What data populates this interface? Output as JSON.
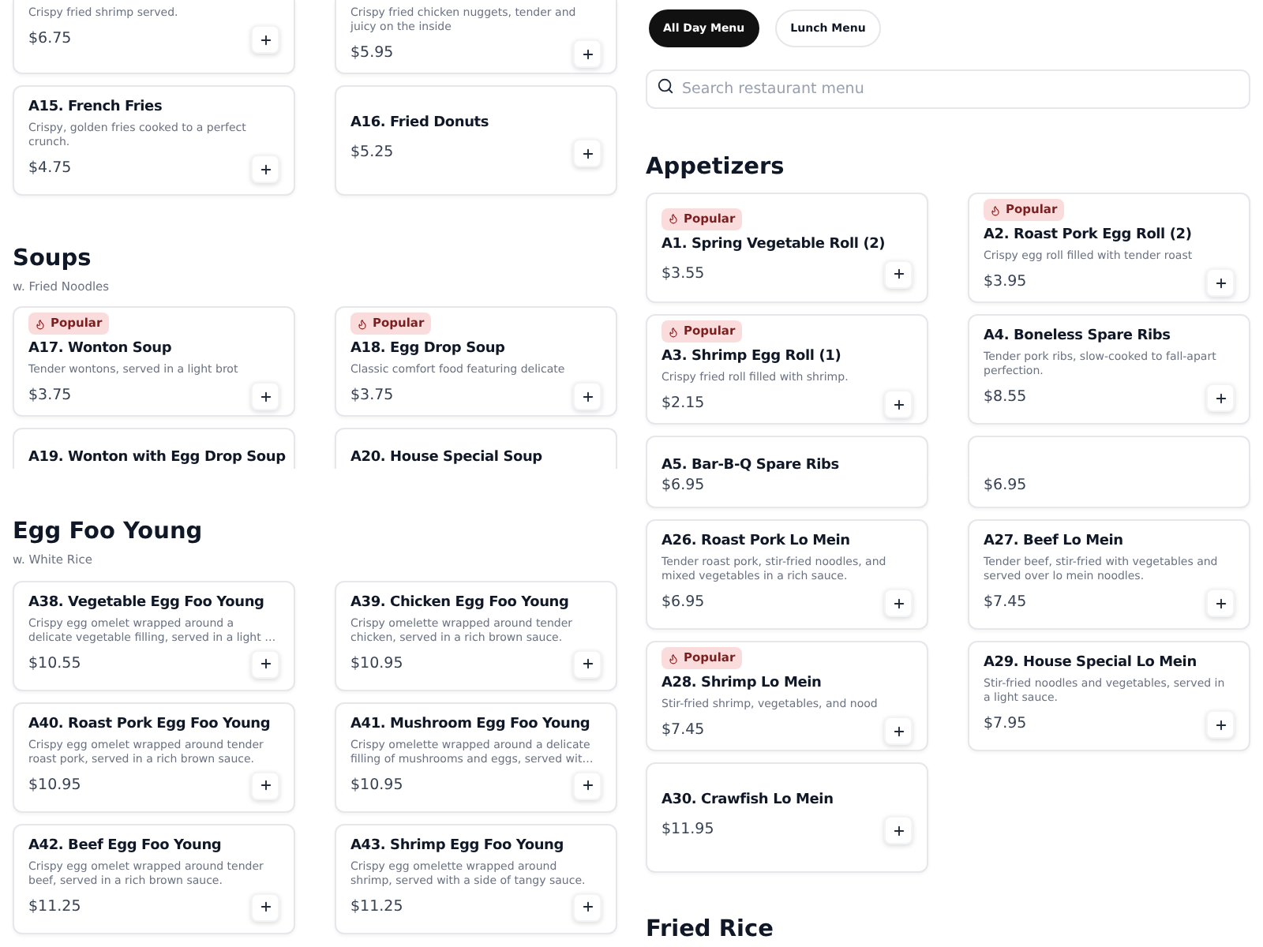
{
  "menu_tabs": [
    {
      "label": "All Day Menu",
      "selected": true
    },
    {
      "label": "Lunch Menu",
      "selected": false
    }
  ],
  "search": {
    "placeholder": "Search restaurant menu"
  },
  "left_column": {
    "blocks": [
      {
        "kind": "cards_top_cut",
        "cards": [
          {
            "description": "Crispy fried shrimp served.",
            "price": "$6.75"
          },
          {
            "description": "Crispy fried chicken nuggets, tender and juicy on the inside",
            "price": "$5.95"
          }
        ]
      },
      {
        "kind": "cards",
        "cards": [
          {
            "title": "A15. French Fries",
            "description": "Crispy, golden fries cooked to a perfect crunch.",
            "price": "$4.75"
          },
          {
            "title": "A16. Fried Donuts",
            "price": "$5.25"
          }
        ]
      },
      {
        "kind": "heading",
        "title": "Soups",
        "subtitle": "w. Fried Noodles"
      },
      {
        "kind": "cards",
        "cards": [
          {
            "badge": "Popular",
            "title": "A17. Wonton Soup",
            "description": "Tender wontons, served in a light brot",
            "price": "$3.75"
          },
          {
            "badge": "Popular",
            "title": "A18. Egg Drop Soup",
            "description": "Classic comfort food featuring delicate",
            "price": "$3.75"
          }
        ]
      },
      {
        "kind": "cards_bottom_cut",
        "cards": [
          {
            "title": "A19. Wonton with Egg Drop Soup"
          },
          {
            "title": "A20. House Special Soup"
          }
        ]
      },
      {
        "kind": "heading",
        "title": "Egg Foo Young",
        "subtitle": "w. White Rice"
      },
      {
        "kind": "cards",
        "cards": [
          {
            "title": "A38. Vegetable Egg Foo Young",
            "description": "Crispy egg omelet wrapped around a delicate vegetable filling, served in a light …",
            "price": "$10.55"
          },
          {
            "title": "A39. Chicken Egg Foo Young",
            "description": "Crispy omelette wrapped around tender chicken, served in a rich brown sauce.",
            "price": "$10.95"
          }
        ]
      },
      {
        "kind": "cards",
        "cards": [
          {
            "title": "A40. Roast Pork Egg Foo Young",
            "description": "Crispy egg omelet wrapped around tender roast pork, served in a rich brown sauce.",
            "price": "$10.95"
          },
          {
            "title": "A41. Mushroom Egg Foo Young",
            "description": "Crispy omelette wrapped around a delicate filling of mushrooms and eggs, served wit…",
            "price": "$10.95"
          }
        ]
      },
      {
        "kind": "cards",
        "cards": [
          {
            "title": "A42. Beef Egg Foo Young",
            "description": "Crispy egg omelet wrapped around tender beef, served in a rich brown sauce.",
            "price": "$11.25"
          },
          {
            "title": "A43. Shrimp Egg Foo Young",
            "description": "Crispy egg omelette wrapped around shrimp, served with a side of tangy sauce.",
            "price": "$11.25"
          }
        ]
      }
    ]
  },
  "right_column": {
    "blocks": [
      {
        "kind": "heading",
        "title": "Appetizers"
      },
      {
        "kind": "cards",
        "cards": [
          {
            "badge": "Popular",
            "title": "A1. Spring Vegetable Roll (2)",
            "price": "$3.55"
          },
          {
            "badge": "Popular",
            "title": "A2. Roast Pork Egg Roll (2)",
            "description": "Crispy egg roll filled with tender roast",
            "price": "$3.95"
          }
        ]
      },
      {
        "kind": "cards",
        "cards": [
          {
            "badge": "Popular",
            "title": "A3. Shrimp Egg Roll (1)",
            "description": "Crispy fried roll filled with shrimp.",
            "price": "$2.15"
          },
          {
            "title": "A4. Boneless Spare Ribs",
            "description": "Tender pork ribs, slow-cooked to fall-apart perfection.",
            "price": "$8.55"
          }
        ]
      },
      {
        "kind": "cards_bottom_cut",
        "cards": [
          {
            "title": "A5. Bar-B-Q Spare Ribs"
          },
          {
            "kind": "empty"
          }
        ]
      },
      {
        "kind": "cards_fragment",
        "cards": [
          {
            "price": "$6.95"
          },
          {
            "price": "$6.95"
          }
        ]
      },
      {
        "kind": "cards",
        "cards": [
          {
            "title": "A26. Roast Pork Lo Mein",
            "description": "Tender roast pork, stir-fried noodles, and mixed vegetables in a rich sauce.",
            "price": "$6.95"
          },
          {
            "title": "A27. Beef Lo Mein",
            "description": "Tender beef, stir-fried with vegetables and served over lo mein noodles.",
            "price": "$7.45"
          }
        ]
      },
      {
        "kind": "cards",
        "cards": [
          {
            "badge": "Popular",
            "title": "A28. Shrimp Lo Mein",
            "description": "Stir-fried shrimp, vegetables, and nood",
            "price": "$7.45"
          },
          {
            "title": "A29. House Special Lo Mein",
            "description": "Stir-fried noodles and vegetables, served in a light sauce.",
            "price": "$7.95"
          }
        ]
      },
      {
        "kind": "cards",
        "cards": [
          {
            "title": "A30. Crawfish Lo Mein",
            "price": "$11.95"
          }
        ]
      },
      {
        "kind": "heading",
        "title": "Fried Rice"
      }
    ]
  }
}
